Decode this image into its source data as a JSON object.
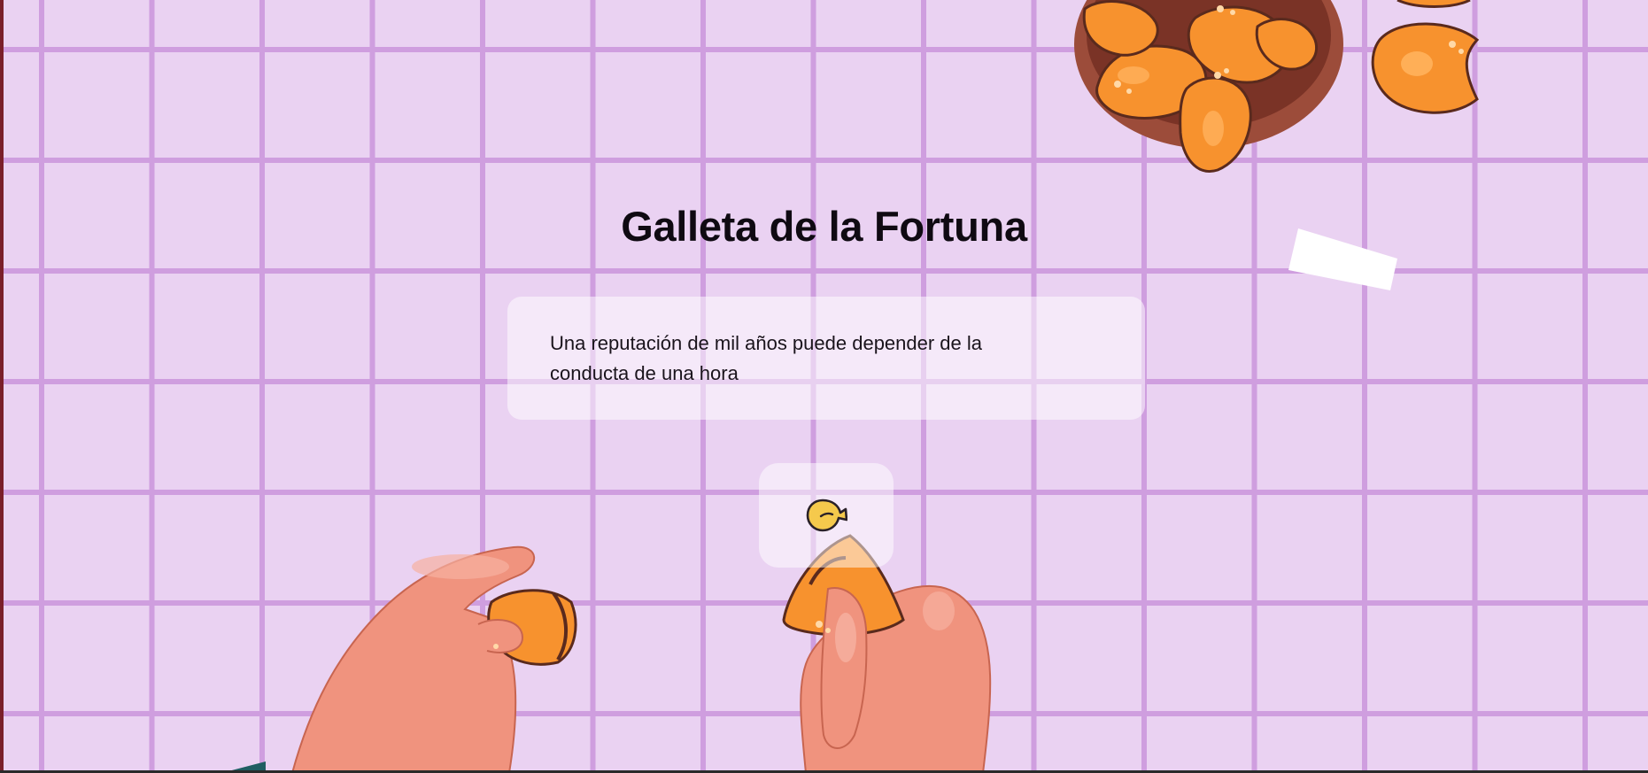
{
  "page": {
    "title": "Galleta de la Fortuna",
    "fortune": "Una reputación de mil años puede depender de la conducta de una hora"
  },
  "button": {
    "icon": "fortune-cookie-icon"
  },
  "colors": {
    "background": "#ead2f2",
    "grid_lines": "#cf9edf",
    "card": "rgba(255,255,255,0.52)",
    "cookie": "#f7922e",
    "hand": "#f0937e"
  }
}
